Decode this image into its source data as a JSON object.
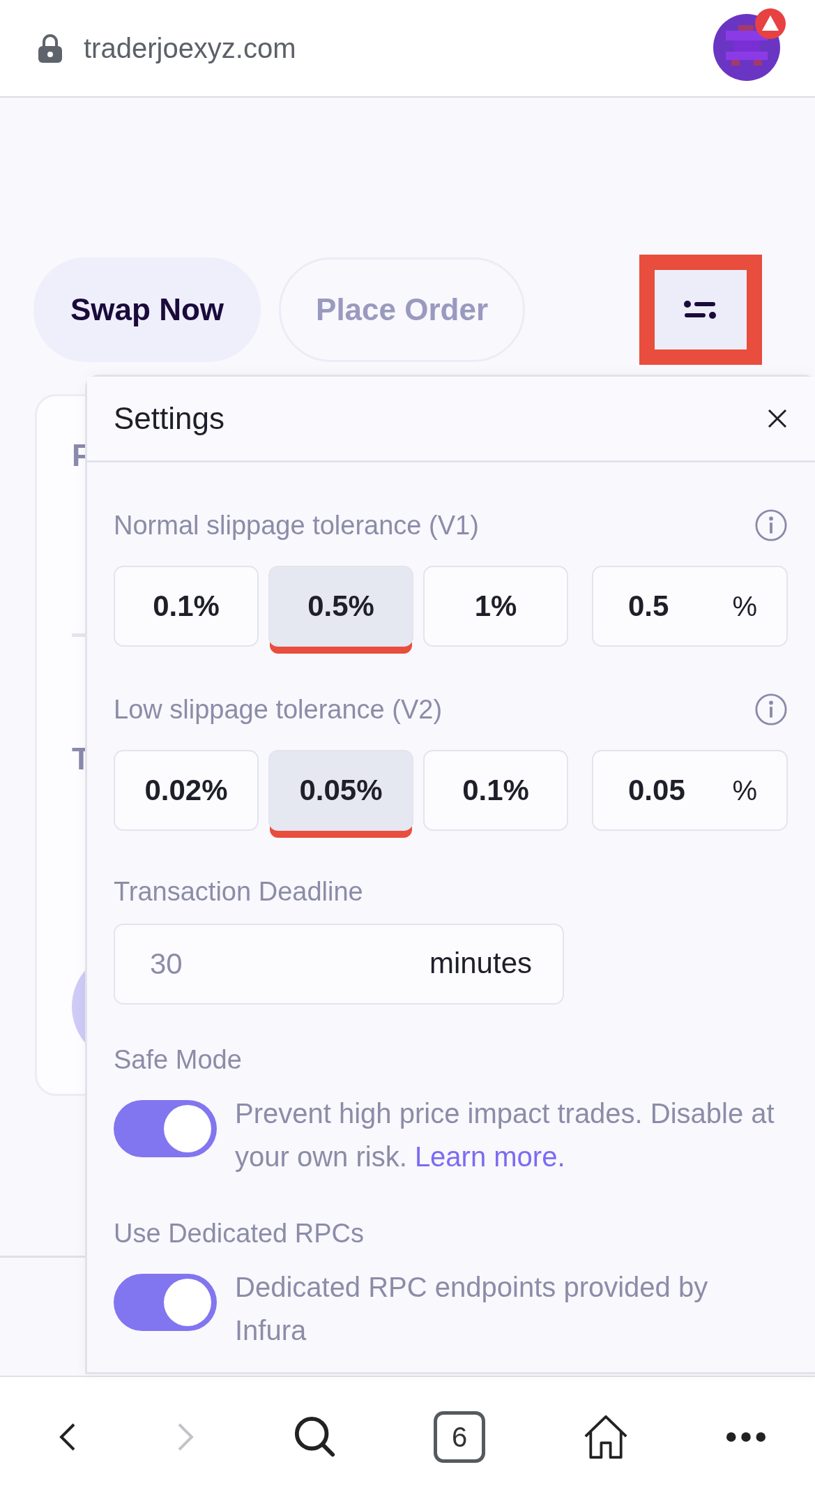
{
  "browser": {
    "url": "traderjoexyz.com"
  },
  "tabs": [
    {
      "label": "Swap Now",
      "selected": true
    },
    {
      "label": "Place Order",
      "selected": false
    }
  ],
  "settings_button": {
    "highlighted": true
  },
  "card": {
    "texts": [
      {
        "kind": "label",
        "text": "F"
      },
      {
        "kind": "divider"
      },
      {
        "kind": "label",
        "text": "T"
      },
      {
        "kind": "button"
      }
    ]
  },
  "settings": {
    "title": "Settings",
    "groups": [
      {
        "label": "Normal slippage tolerance (V1)",
        "options": [
          {
            "label": "0.1%",
            "selected": false
          },
          {
            "label": "0.5%",
            "selected": true
          },
          {
            "label": "1%",
            "selected": false
          }
        ],
        "custom": {
          "value": "0.5",
          "unit": "%"
        }
      },
      {
        "label": "Low slippage tolerance (V2)",
        "options": [
          {
            "label": "0.02%",
            "selected": false
          },
          {
            "label": "0.05%",
            "selected": true
          },
          {
            "label": "0.1%",
            "selected": false
          }
        ],
        "custom": {
          "value": "0.05",
          "unit": "%"
        }
      }
    ],
    "deadline": {
      "label": "Transaction Deadline",
      "placeholder": "30",
      "unit": "minutes"
    },
    "toggles": [
      {
        "label": "Safe Mode",
        "on": true,
        "description": "Prevent high price impact trades. Disable at your own risk.",
        "link": "Learn more."
      },
      {
        "label": "Use Dedicated RPCs",
        "on": true,
        "description": "Dedicated RPC endpoints provided by Infura"
      }
    ]
  },
  "bottom_bar": {
    "tab_count": "6",
    "forward_disabled": true
  }
}
